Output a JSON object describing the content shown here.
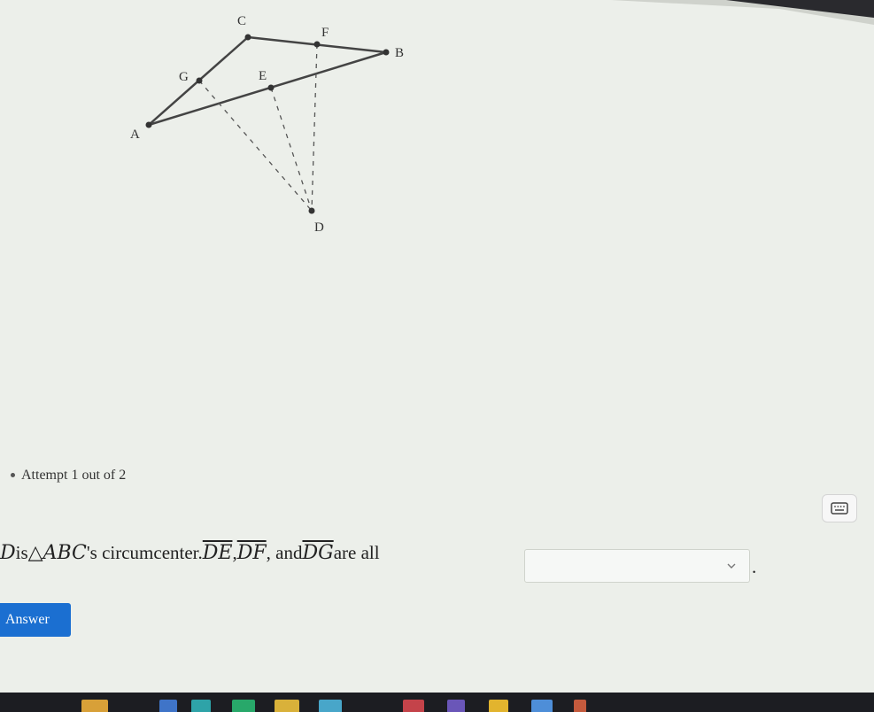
{
  "diagram": {
    "points": [
      {
        "label": "A"
      },
      {
        "label": "B"
      },
      {
        "label": "C"
      },
      {
        "label": "D"
      },
      {
        "label": "E"
      },
      {
        "label": "F"
      },
      {
        "label": "G"
      }
    ]
  },
  "attempt": {
    "text": "Attempt 1 out of 2"
  },
  "question": {
    "p1": "D",
    "p2": " is ",
    "p3": "△ABC",
    "p4": "'s circumcenter. ",
    "p5": "DE",
    "p6": ", ",
    "p7": "DF",
    "p8": ", and ",
    "p9": "DG",
    "p10": " are all",
    "period": "."
  },
  "answer_select": {
    "selected": ""
  },
  "answer_button": {
    "label": "Answer"
  },
  "icons": {
    "keyboard": "keyboard-icon",
    "chevron": "chevron-down-icon"
  },
  "colors": {
    "accent": "#1b6fd1",
    "taskbar": "#1c1d22"
  }
}
